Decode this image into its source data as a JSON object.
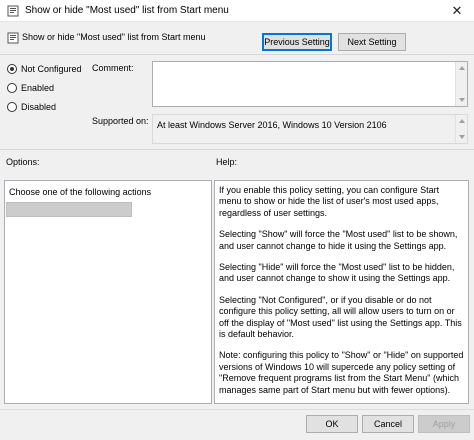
{
  "window": {
    "title": "Show or hide \"Most used\" list from Start menu",
    "close_glyph": "✕"
  },
  "policy": {
    "name": "Show or hide \"Most used\" list from Start menu"
  },
  "nav": {
    "previous_label": "Previous Setting",
    "next_label": "Next Setting"
  },
  "state": {
    "options": [
      {
        "label": "Not Configured",
        "selected": true
      },
      {
        "label": "Enabled",
        "selected": false
      },
      {
        "label": "Disabled",
        "selected": false
      }
    ]
  },
  "comment": {
    "label": "Comment:",
    "value": ""
  },
  "supported": {
    "label": "Supported on:",
    "value": "At least Windows Server 2016, Windows 10 Version 2106"
  },
  "options_panel": {
    "label": "Options:",
    "instruction": "Choose one of the following actions",
    "dropdown_value": ""
  },
  "help_panel": {
    "label": "Help:",
    "paragraphs": [
      "If you enable this policy setting, you can configure Start menu to show or hide the list of user's most used apps, regardless of user settings.",
      "Selecting \"Show\" will force the \"Most used\" list to be shown, and user cannot change to hide it using the Settings app.",
      "Selecting \"Hide\" will force the \"Most used\" list to be hidden, and user cannot change to show it using the Settings app.",
      "Selecting \"Not Configured\", or if you disable or do not configure this policy setting, all will allow users to turn on or off the display of \"Most used\" list using the Settings app. This is default behavior.",
      "Note: configuring this policy to \"Show\" or \"Hide\" on supported versions of Windows 10 will supercede any policy setting of \"Remove frequent programs list from the Start Menu\" (which manages same part of Start menu but with fewer options)."
    ]
  },
  "footer": {
    "ok_label": "OK",
    "cancel_label": "Cancel",
    "apply_label": "Apply"
  },
  "colors": {
    "accent": "#0078d7",
    "window_bg": "#f0f0f0"
  }
}
